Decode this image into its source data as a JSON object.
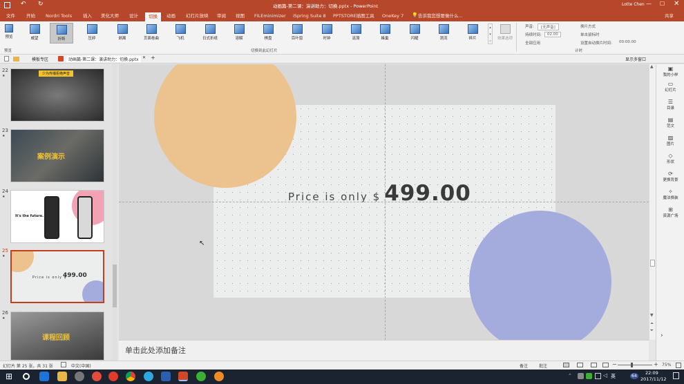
{
  "window": {
    "title": "动画篇-第二课：演讲助力：切换.pptx - PowerPoint",
    "user": "Lotte Chen",
    "share": "共享"
  },
  "tabs": [
    "文件",
    "开始",
    "Nordri Tools",
    "插入",
    "美化大师",
    "设计",
    "切换",
    "动画",
    "幻灯片放映",
    "审阅",
    "视图",
    "FILEminimizer",
    "iSpring Suite 8",
    "PPTSTORE插图工具",
    "OneKey 7"
  ],
  "tell_me": "告诉我您想要做什么...",
  "ribbon": {
    "preview_label": "预览",
    "preview_group": "预览",
    "transitions": [
      "威望",
      "折断",
      "压碎",
      "剥离",
      "页面卷曲",
      "飞机",
      "日式折纸",
      "溶解",
      "棋盘",
      "百叶窗",
      "时钟",
      "涟漪",
      "蜂巢",
      "闪耀",
      "涡流",
      "碎片"
    ],
    "effect_options": "效果选项",
    "group_label": "切换到此幻灯片",
    "sound_label": "声音:",
    "sound_value": "[无声音]",
    "duration_label": "持续时间:",
    "duration_value": "02.00",
    "apply_all": "全部应用",
    "switch_label": "换片方式",
    "on_click": "单击鼠标时",
    "after_label": "设置自动换片时间:",
    "after_value": "00:00.00",
    "timing_group": "计时"
  },
  "doc_tabs": {
    "template_tab": "模板专区",
    "file_tab": "动画篇-第二课：演讲助力：切换.pptx",
    "multi_window": "显示多窗口"
  },
  "thumbnails": [
    {
      "num": "22",
      "label": "少为传播拒绝声音"
    },
    {
      "num": "23",
      "label": "案例演示"
    },
    {
      "num": "24",
      "label": "It's the future."
    },
    {
      "num": "25",
      "label_a": "Price is only $",
      "label_b": "499.00"
    },
    {
      "num": "26",
      "label": "课程回顾"
    }
  ],
  "slide": {
    "price_prefix": "Price is only $",
    "price_value": "499.00"
  },
  "notes_placeholder": "单击此处添加备注",
  "right_panel": [
    "我的小样",
    "幻灯片",
    "目录",
    "范文",
    "图片",
    "形状",
    "更换背景",
    "魔法换装",
    "资源广场"
  ],
  "status": {
    "slide_info": "幻灯片 第 25 张，共 31 张",
    "language": "中文(中国)",
    "notes_btn": "备注",
    "comments_btn": "批注",
    "zoom": "75%"
  },
  "taskbar": {
    "time": "22:09",
    "date": "2017/11/12",
    "ime": "英",
    "badge": "64"
  },
  "colors": {
    "accent": "#b7472a",
    "orange_circle": "#ecc28e",
    "blue_circle": "#a4acdd",
    "slide_bg": "#eceeee"
  }
}
